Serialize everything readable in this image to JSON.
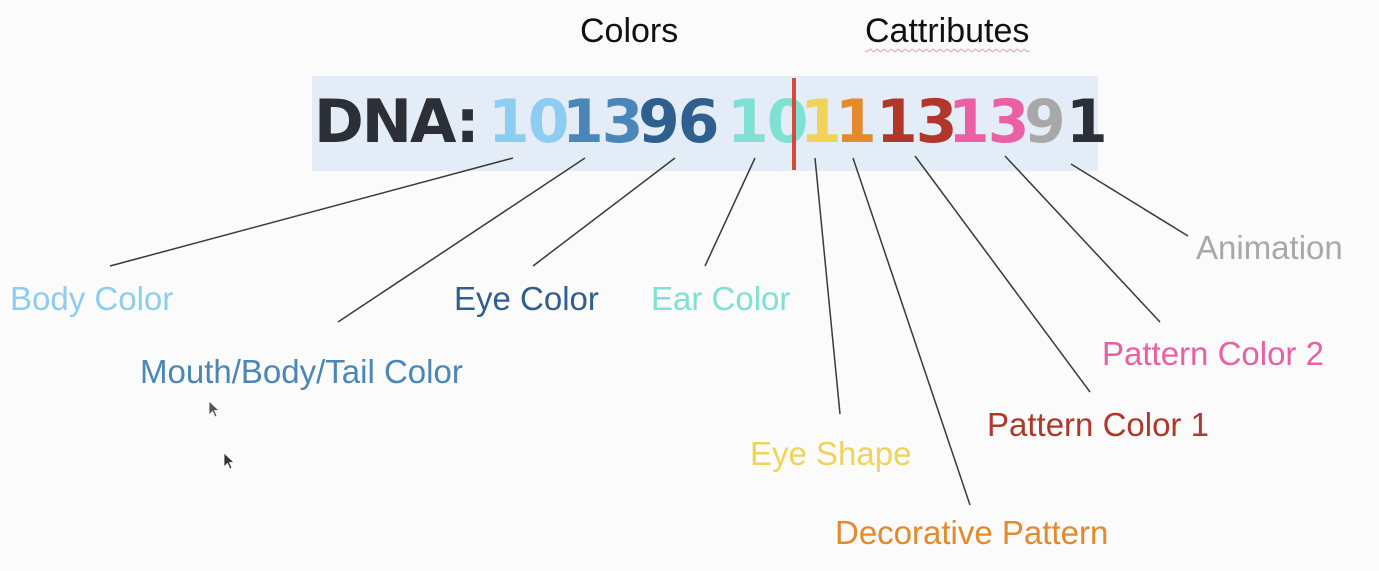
{
  "headings": {
    "colors": "Colors",
    "cattributes": "Cattributes"
  },
  "dna": {
    "prefix": "DNA:",
    "prefix_color": "#2c2f35",
    "segments": [
      {
        "value": "10",
        "color": "#8ecdf2"
      },
      {
        "value": "13",
        "color": "#4a86b8"
      },
      {
        "value": "96",
        "color": "#2f5f8f"
      },
      {
        "value": "10",
        "color": "#7fe0d4"
      },
      {
        "value": "1",
        "color": "#f2d35a"
      },
      {
        "value": "1",
        "color": "#e58a2c"
      },
      {
        "value": "13",
        "color": "#b1372a"
      },
      {
        "value": "13",
        "color": "#ec5fa4"
      },
      {
        "value": "9",
        "color": "#a8a8a8"
      },
      {
        "value": "1",
        "color": "#2c2f35"
      }
    ],
    "divider_color": "#d24a3a"
  },
  "labels": {
    "body_color": "Body Color",
    "mouth_body_tail_color": "Mouth/Body/Tail Color",
    "eye_color": "Eye Color",
    "ear_color": "Ear Color",
    "eye_shape": "Eye Shape",
    "decorative_pattern": "Decorative Pattern",
    "pattern_color_1": "Pattern Color 1",
    "pattern_color_2": "Pattern Color 2",
    "animation": "Animation"
  },
  "label_colors": {
    "body_color": "#8ecdf2",
    "mouth_body_tail_color": "#4a86b8",
    "eye_color": "#2f5f8f",
    "ear_color": "#7fe0d4",
    "eye_shape": "#f2d35a",
    "decorative_pattern": "#e58a2c",
    "pattern_color_1": "#b1372a",
    "pattern_color_2": "#ec5fa4",
    "animation": "#a8a8a8"
  }
}
